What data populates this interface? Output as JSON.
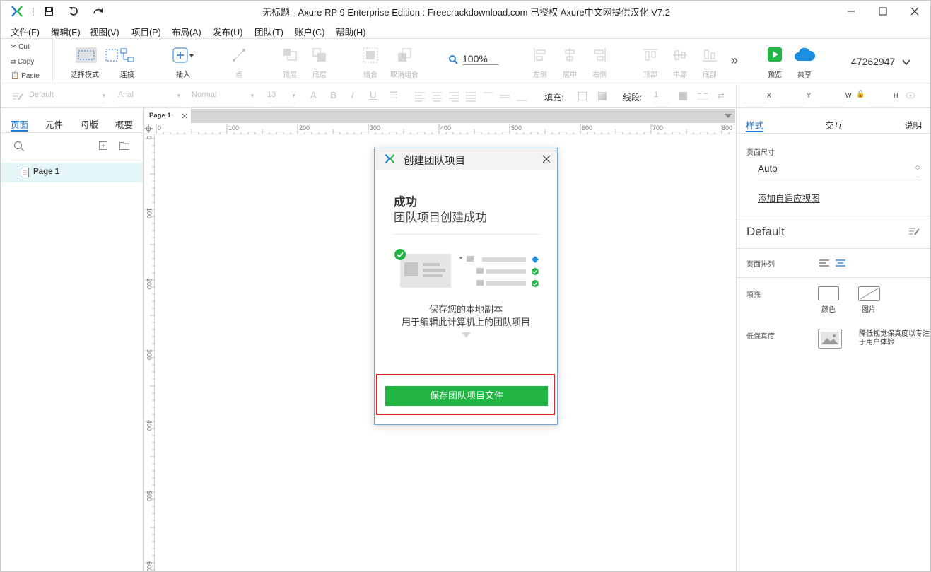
{
  "titlebar": {
    "title": "无标题 - Axure RP 9 Enterprise Edition : Freecrackdownload.com 已授权    Axure中文网提供汉化 V7.2",
    "separator": "|"
  },
  "menu": [
    "文件(F)",
    "编辑(E)",
    "视图(V)",
    "项目(P)",
    "布局(A)",
    "发布(U)",
    "团队(T)",
    "账户(C)",
    "帮助(H)"
  ],
  "clipboard": {
    "cut": "Cut",
    "copy": "Copy",
    "paste": "Paste"
  },
  "toolbar": {
    "select_mode": "选择模式",
    "connect": "连接",
    "insert": "插入",
    "point": "点",
    "top_layer": "顶层",
    "bottom_layer": "底层",
    "group": "组合",
    "ungroup": "取消组合",
    "zoom": "100%",
    "align_left": "左侧",
    "align_center": "居中",
    "align_right": "右侧",
    "align_top": "顶部",
    "align_middle": "中部",
    "align_bottom": "底部",
    "more": "»",
    "preview": "预览",
    "share": "共享",
    "user_id": "47262947"
  },
  "formatbar": {
    "style": "Default",
    "font": "Arial",
    "weight": "Normal",
    "size": "13",
    "fill_label": "填充:",
    "stroke_label": "线段:",
    "stroke_value": "1",
    "x_label": "X",
    "y_label": "Y",
    "w_label": "W",
    "h_label": "H"
  },
  "leftpanel": {
    "tabs": [
      "页面",
      "元件",
      "母版",
      "概要"
    ],
    "active_tab": "页面",
    "pages": [
      {
        "label": "Page 1"
      }
    ]
  },
  "canvas": {
    "tab_label": "Page 1",
    "ruler_h": [
      "0",
      "100",
      "200",
      "300",
      "400",
      "500",
      "600",
      "700",
      "800"
    ],
    "ruler_v": [
      "0",
      "100",
      "200",
      "300",
      "400",
      "500",
      "600"
    ]
  },
  "rightpanel": {
    "tabs": [
      "样式",
      "交互",
      "说明"
    ],
    "active_tab": "样式",
    "page_size_label": "页面尺寸",
    "page_size_value": "Auto",
    "adaptive_link": "添加自适应视图",
    "style_name": "Default",
    "page_align_label": "页面排列",
    "fill_label": "填充",
    "fill_color": "颜色",
    "fill_image": "图片",
    "low_fidelity_label": "低保真度",
    "low_fidelity_desc": "降低视觉保真度以专注于用户体验"
  },
  "dialog": {
    "title": "创建团队项目",
    "heading": "成功",
    "subheading": "团队项目创建成功",
    "line1": "保存您的本地副本",
    "line2": "用于编辑此计算机上的团队项目",
    "button": "保存团队项目文件"
  },
  "colors": {
    "accent_blue": "#1e7ad8",
    "success_green": "#21b544",
    "highlight_red": "#d9262c",
    "selected_page_bg": "#e5f6f8"
  }
}
